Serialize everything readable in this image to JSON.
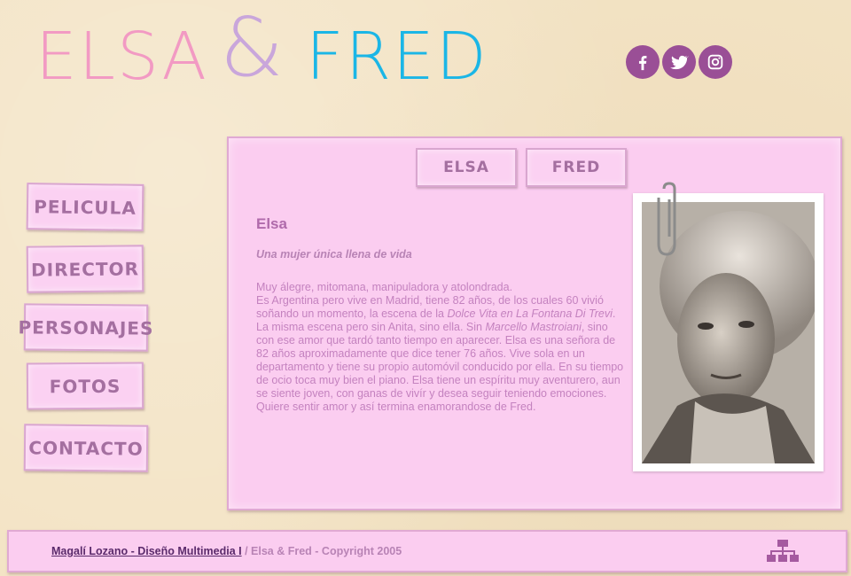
{
  "header": {
    "logo_word1": "ELSA",
    "logo_amp": "&",
    "logo_word2": "FRED",
    "social": [
      "facebook-icon",
      "twitter-icon",
      "instagram-icon"
    ]
  },
  "nav": {
    "items": [
      {
        "label": "PELICULA"
      },
      {
        "label": "DIRECTOR"
      },
      {
        "label": "PERSONAJES"
      },
      {
        "label": "FOTOS"
      },
      {
        "label": "CONTACTO"
      }
    ]
  },
  "character_tabs": [
    {
      "label": "ELSA"
    },
    {
      "label": "FRED"
    }
  ],
  "content": {
    "name": "Elsa",
    "subtitle": "Una mujer única llena de vida",
    "p1": "Muy álegre, mitomana, manipuladora y atolondrada.",
    "p2_a": "Es Argentina pero vive en Madrid, tiene 82 años, de los cuales 60 vivió soñando un momento, la escena de la ",
    "p2_italic1": "Dolce Vita en La Fontana Di Trevi",
    "p2_b": ". La misma escena pero sin Anita, sino ella. Sin ",
    "p2_italic2": "Marcello Mastroiani",
    "p2_c": ", sino con ese amor que tardó tanto tiempo en aparecer. Elsa es una señora de 82 años aproximadamente que dice tener 76 años. Vive sola en un departamento y tiene su propio automóvil conducido por ella. En su tiempo de ocio toca muy bien el piano. Elsa tiene un espíritu muy aventurero, aun se siente joven, con ganas de vivír y desea seguir teniendo emociones. Quiere sentir amor y así termina enamorandose de Fred."
  },
  "footer": {
    "link": "Magalí Lozano - Diseño Multimedia I",
    "copyright": " / Elsa & Fred - Copyright 2005",
    "sitemap_icon": "sitemap-icon"
  },
  "colors": {
    "background": "#f3e3c4",
    "panel": "#fbcdf0",
    "accent_purple": "#9a4f96",
    "text": "#c482bf",
    "logo_pink": "#f29ac3",
    "logo_lilac": "#c9a6db",
    "logo_blue": "#1bb6e6"
  }
}
